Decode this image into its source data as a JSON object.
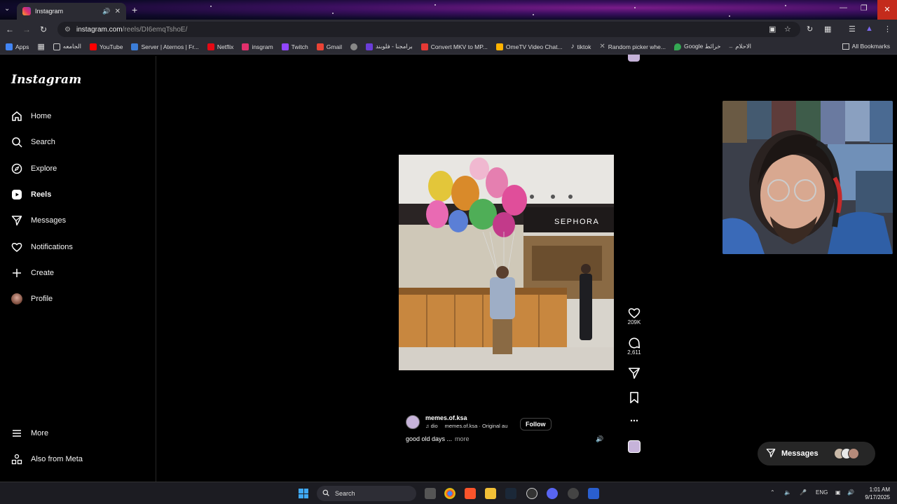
{
  "browser": {
    "tab_title": "Instagram",
    "url_host": "instagram.com",
    "url_path": "/reels/DI6emqTshoE/",
    "bookmarks": [
      {
        "label": "Apps",
        "color": "#4285f4"
      },
      {
        "label": "الجامعه",
        "color": "#c7a76b"
      },
      {
        "label": "YouTube",
        "color": "#ff0000"
      },
      {
        "label": "Server | Aternos | Fr...",
        "color": "#3b7dd8"
      },
      {
        "label": "Netflix",
        "color": "#e50914"
      },
      {
        "label": "insgram",
        "color": "#e1306c"
      },
      {
        "label": "Twitch",
        "color": "#9146ff"
      },
      {
        "label": "Gmail",
        "color": "#ea4335"
      },
      {
        "label": "",
        "color": "#888888"
      },
      {
        "label": "برامجنا - فلوبند",
        "color": "#6a3dd8"
      },
      {
        "label": "Convert MKV to MP...",
        "color": "#e53935"
      },
      {
        "label": "OmeTV Video Chat...",
        "color": "#ffb300"
      },
      {
        "label": "tiktok",
        "color": "#000000"
      },
      {
        "label": "Random picker whe...",
        "color": "#777777"
      },
      {
        "label": "Google خرائط",
        "color": "#34a853"
      },
      {
        "label": "الاحلام",
        "color": "#999999"
      }
    ],
    "all_bookmarks": "All Bookmarks"
  },
  "instagram": {
    "logo": "Instagram",
    "nav": [
      {
        "label": "Home",
        "icon": "home-icon"
      },
      {
        "label": "Search",
        "icon": "search-icon"
      },
      {
        "label": "Explore",
        "icon": "compass-icon"
      },
      {
        "label": "Reels",
        "icon": "reels-icon"
      },
      {
        "label": "Messages",
        "icon": "messages-icon"
      },
      {
        "label": "Notifications",
        "icon": "heart-icon"
      },
      {
        "label": "Create",
        "icon": "plus-icon"
      },
      {
        "label": "Profile",
        "icon": "profile-avatar"
      }
    ],
    "more": "More",
    "also_from_meta": "Also from Meta",
    "reel": {
      "likes": "209K",
      "comments": "2,611",
      "username": "memes.of.ksa",
      "audio_artist": "dio",
      "audio_track": "memes.of.ksa · Original au",
      "follow": "Follow",
      "caption": "good old days ...",
      "caption_more": "more",
      "store_sign": "SEPHORA"
    },
    "messages_pill": "Messages"
  },
  "taskbar": {
    "search": "Search",
    "lang": "ENG",
    "time": "1:01 AM",
    "date": "9/17/2025"
  }
}
